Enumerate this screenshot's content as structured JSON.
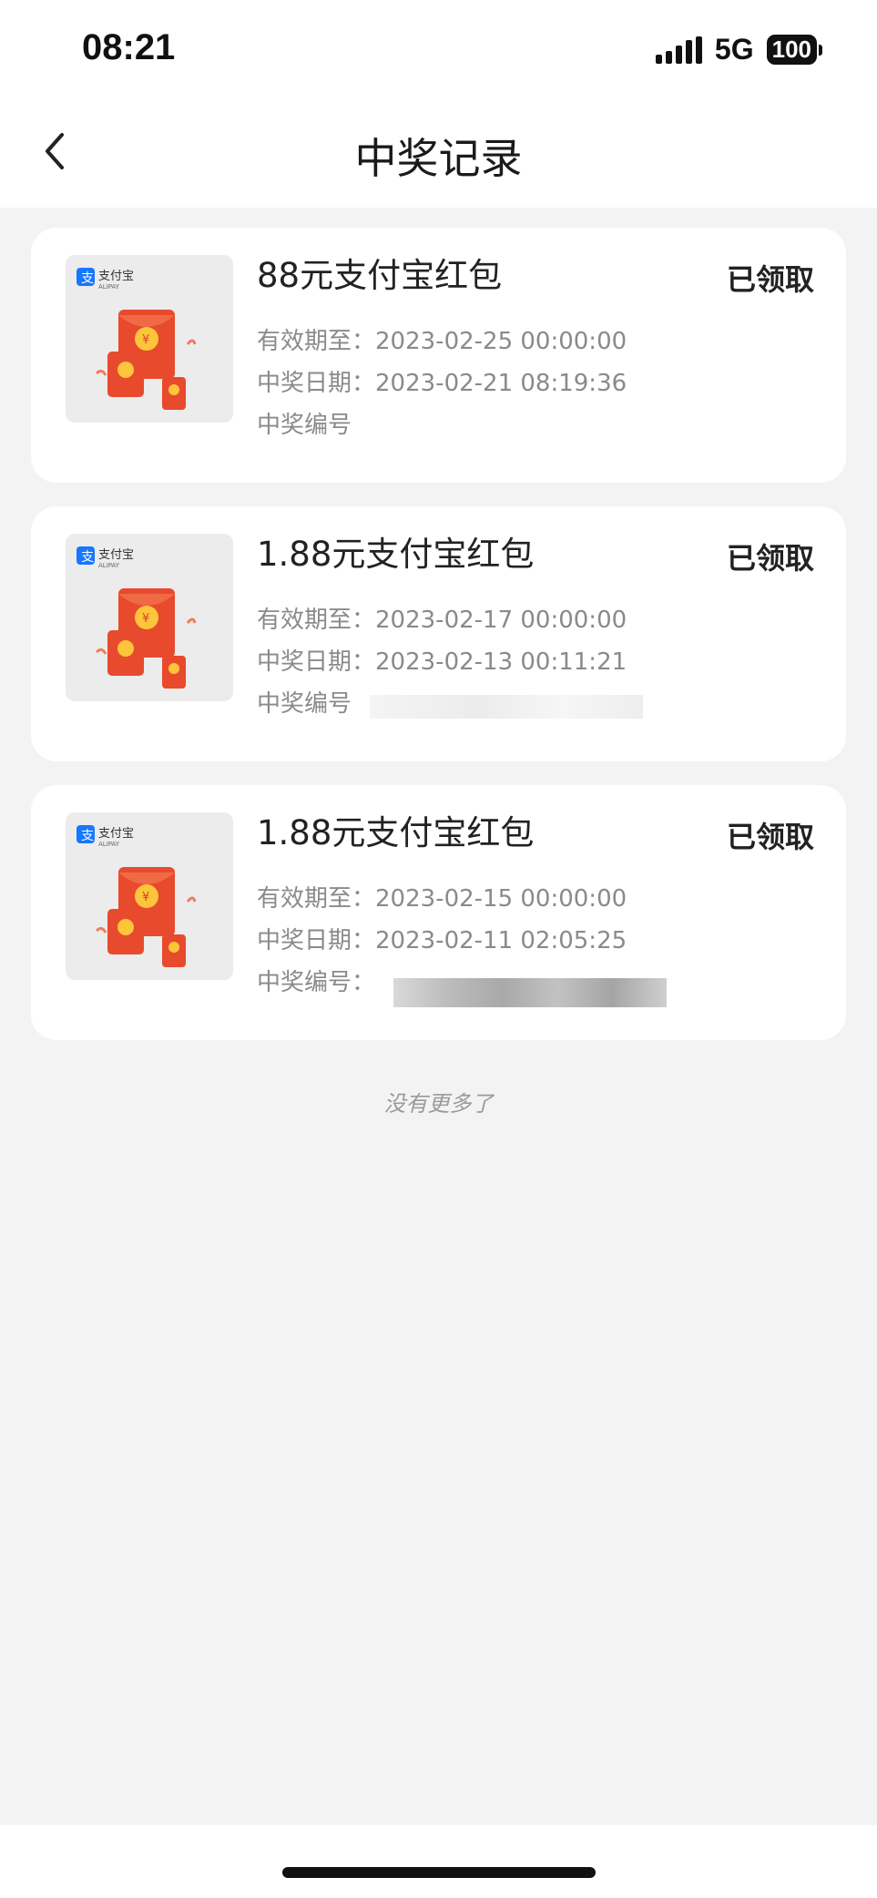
{
  "status_bar": {
    "time": "08:21",
    "network": "5G",
    "battery": "100"
  },
  "nav": {
    "title": "中奖记录",
    "back_icon": "chevron-left-icon"
  },
  "thumb": {
    "brand_cn": "支付宝",
    "brand_en": "ALIPAY",
    "icon": "red-envelope-icon",
    "accent": "#e84a2e"
  },
  "labels": {
    "expire": "有效期至：",
    "win_date": "中奖日期：",
    "number": "中奖编号："
  },
  "records": [
    {
      "title": "88元支付宝红包",
      "status": "已领取",
      "expire": "2023-02-25 00:00:00",
      "win_date": "2023-02-21 08:19:36",
      "number_label": "中奖编号"
    },
    {
      "title": "1.88元支付宝红包",
      "status": "已领取",
      "expire": "2023-02-17 00:00:00",
      "win_date": "2023-02-13 00:11:21",
      "number_label": "中奖编号"
    },
    {
      "title": "1.88元支付宝红包",
      "status": "已领取",
      "expire": "2023-02-15 00:00:00",
      "win_date": "2023-02-11 02:05:25",
      "number_label": "中奖编号："
    }
  ],
  "footer": {
    "no_more": "没有更多了"
  }
}
